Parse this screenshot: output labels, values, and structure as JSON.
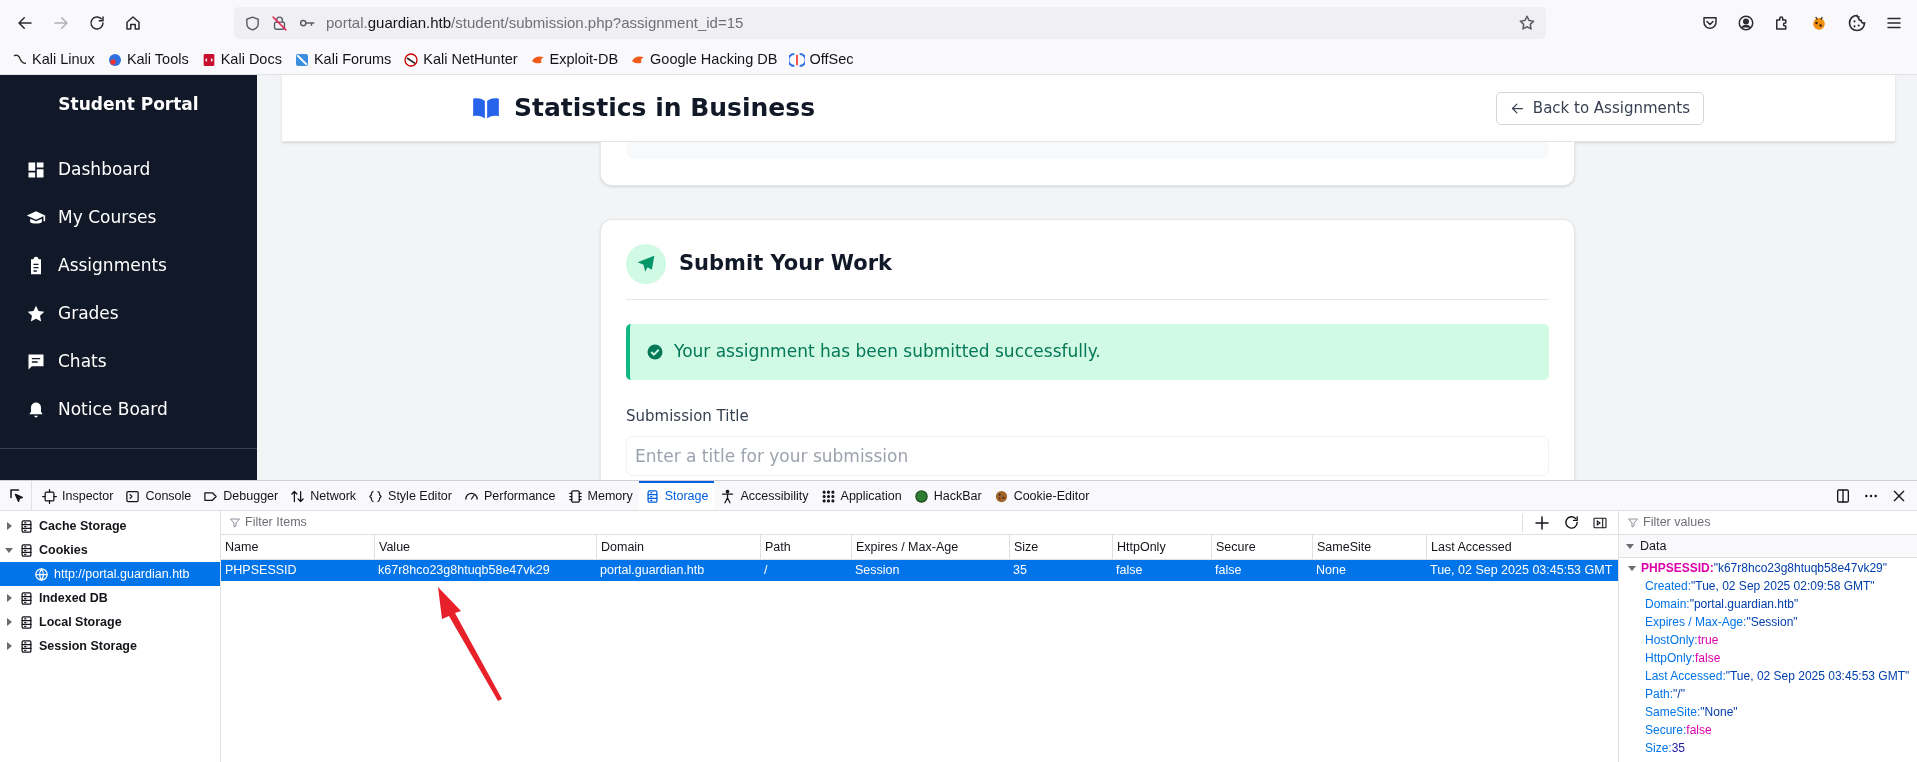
{
  "browser": {
    "url": {
      "prefix": "portal.",
      "domain": "guardian.htb",
      "path": "/student/submission.php?assignment_id=15"
    },
    "bookmarks": [
      "Kali Linux",
      "Kali Tools",
      "Kali Docs",
      "Kali Forums",
      "Kali NetHunter",
      "Exploit-DB",
      "Google Hacking DB",
      "OffSec"
    ]
  },
  "sidebar": {
    "title": "Student Portal",
    "items": [
      {
        "label": "Dashboard"
      },
      {
        "label": "My Courses"
      },
      {
        "label": "Assignments"
      },
      {
        "label": "Grades"
      },
      {
        "label": "Chats"
      },
      {
        "label": "Notice Board"
      }
    ]
  },
  "header": {
    "title": "Statistics in Business",
    "back_button": "Back to Assignments"
  },
  "submit_card": {
    "title": "Submit Your Work",
    "alert": "Your assignment has been submitted successfully.",
    "field_label": "Submission Title",
    "placeholder": "Enter a title for your submission"
  },
  "devtools": {
    "tabs": [
      {
        "label": "Inspector",
        "selected": false
      },
      {
        "label": "Console",
        "selected": false
      },
      {
        "label": "Debugger",
        "selected": false
      },
      {
        "label": "Network",
        "selected": false
      },
      {
        "label": "Style Editor",
        "selected": false
      },
      {
        "label": "Performance",
        "selected": false
      },
      {
        "label": "Memory",
        "selected": false
      },
      {
        "label": "Storage",
        "selected": true
      },
      {
        "label": "Accessibility",
        "selected": false
      },
      {
        "label": "Application",
        "selected": false
      },
      {
        "label": "HackBar",
        "selected": false
      },
      {
        "label": "Cookie-Editor",
        "selected": false
      }
    ],
    "tree": [
      {
        "label": "Cache Storage",
        "expanded": false,
        "selected": false
      },
      {
        "label": "Cookies",
        "expanded": true,
        "selected": false,
        "children": [
          {
            "label": "http://portal.guardian.htb",
            "selected": true
          }
        ]
      },
      {
        "label": "Indexed DB",
        "expanded": false,
        "selected": false
      },
      {
        "label": "Local Storage",
        "expanded": false,
        "selected": false
      },
      {
        "label": "Session Storage",
        "expanded": false,
        "selected": false
      }
    ],
    "filter_placeholder": "Filter Items",
    "columns": [
      "Name",
      "Value",
      "Domain",
      "Path",
      "Expires / Max-Age",
      "Size",
      "HttpOnly",
      "Secure",
      "SameSite",
      "Last Accessed"
    ],
    "rows": [
      {
        "selected": true,
        "cells": [
          "PHPSESSID",
          "k67r8hco23g8htuqb58e47vk29",
          "portal.guardian.htb",
          "/",
          "Session",
          "35",
          "false",
          "false",
          "None",
          "Tue, 02 Sep 2025 03:45:53 GMT"
        ]
      }
    ],
    "sidebar": {
      "filter_placeholder": "Filter values",
      "section": "Data",
      "entry": {
        "key": "PHPSESSID:",
        "value": "\"k67r8hco23g8htuqb58e47vk29\"",
        "expanded": true
      },
      "props": [
        {
          "key": "Created:",
          "value": "\"Tue, 02 Sep 2025 02:09:58 GMT\"",
          "kind": "string"
        },
        {
          "key": "Domain:",
          "value": "\"portal.guardian.htb\"",
          "kind": "string"
        },
        {
          "key": "Expires / Max-Age:",
          "value": "\"Session\"",
          "kind": "string"
        },
        {
          "key": "HostOnly:",
          "value": "true",
          "kind": "keyword"
        },
        {
          "key": "HttpOnly:",
          "value": "false",
          "kind": "keyword"
        },
        {
          "key": "Last Accessed:",
          "value": "\"Tue, 02 Sep 2025 03:45:53 GMT\"",
          "kind": "string"
        },
        {
          "key": "Path:",
          "value": "\"/\"",
          "kind": "string"
        },
        {
          "key": "SameSite:",
          "value": "\"None\"",
          "kind": "string"
        },
        {
          "key": "Secure:",
          "value": "false",
          "kind": "keyword"
        },
        {
          "key": "Size:",
          "value": "35",
          "kind": "number"
        }
      ]
    }
  }
}
